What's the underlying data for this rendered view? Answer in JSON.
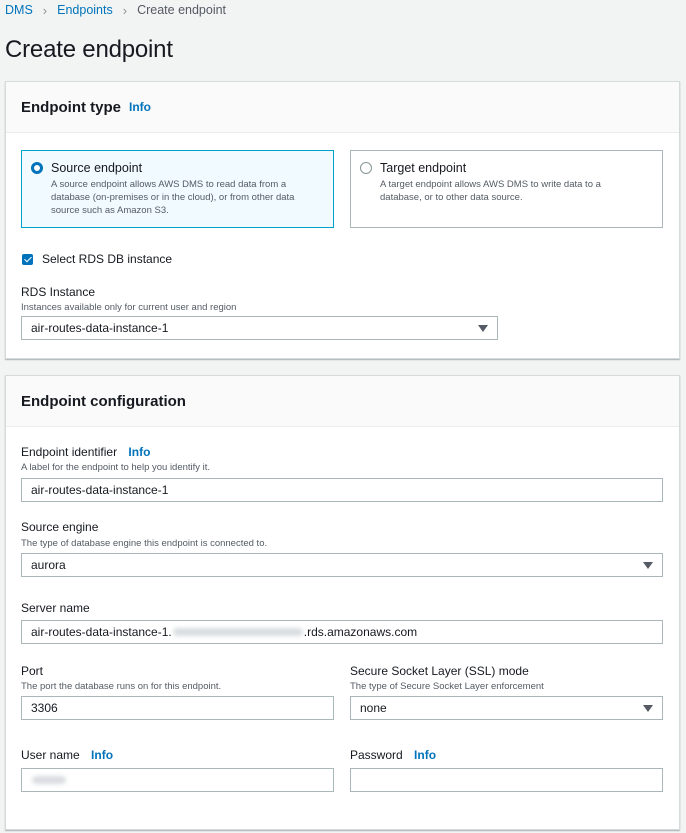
{
  "breadcrumb": {
    "items": [
      "DMS",
      "Endpoints"
    ],
    "current": "Create endpoint"
  },
  "page": {
    "title": "Create endpoint"
  },
  "endpoint_type": {
    "title": "Endpoint type",
    "info": "Info",
    "options": [
      {
        "label": "Source endpoint",
        "desc_lines": [
          "A source endpoint allows AWS DMS to read data from a",
          "database (on-premises or in the cloud), or from other data",
          "source such as Amazon S3."
        ],
        "selected": true
      },
      {
        "label": "Target endpoint",
        "desc_lines": [
          "A target endpoint allows AWS DMS to write data to a",
          "database, or to other data source."
        ],
        "selected": false
      }
    ],
    "rds_checkbox": {
      "label": "Select RDS DB instance",
      "checked": true
    },
    "rds_instance": {
      "label": "RDS Instance",
      "desc": "Instances available only for current user and region",
      "value": "air-routes-data-instance-1"
    }
  },
  "config": {
    "title": "Endpoint configuration",
    "identifier": {
      "label": "Endpoint identifier",
      "info": "Info",
      "desc": "A label for the endpoint to help you identify it.",
      "value": "air-routes-data-instance-1"
    },
    "engine": {
      "label": "Source engine",
      "desc": "The type of database engine this endpoint is connected to.",
      "value": "aurora"
    },
    "server": {
      "label": "Server name",
      "value_prefix": "air-routes-data-instance-1.",
      "value_suffix": ".rds.amazonaws.com"
    },
    "port": {
      "label": "Port",
      "desc": "The port the database runs on for this endpoint.",
      "value": "3306"
    },
    "ssl": {
      "label": "Secure Socket Layer (SSL) mode",
      "desc": "The type of Secure Socket Layer enforcement",
      "value": "none"
    },
    "username": {
      "label": "User name",
      "info": "Info"
    },
    "password": {
      "label": "Password",
      "info": "Info"
    }
  },
  "colors": {
    "link": "#0073bb",
    "selected_border": "#00a1c9",
    "selected_bg": "#f1faff",
    "background": "#f2f3f3"
  }
}
